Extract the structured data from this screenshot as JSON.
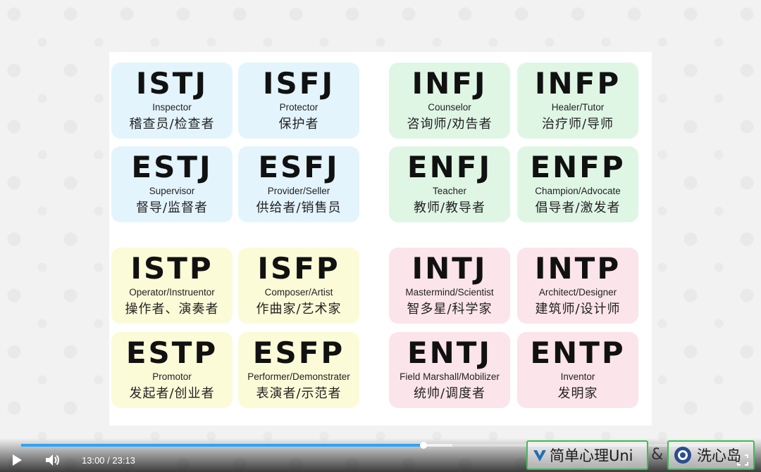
{
  "slide": {
    "cards": [
      {
        "code": "ISTJ",
        "en": "Inspector",
        "cn": "稽查员/检查者",
        "color": "#e3f4fd"
      },
      {
        "code": "ISFJ",
        "en": "Protector",
        "cn": "保护者",
        "color": "#e3f4fd"
      },
      {
        "code": "INFJ",
        "en": "Counselor",
        "cn": "咨询师/劝告者",
        "color": "#dff6e5"
      },
      {
        "code": "INFP",
        "en": "Healer/Tutor",
        "cn": "治疗师/导师",
        "color": "#dff6e5"
      },
      {
        "code": "ESTJ",
        "en": "Supervisor",
        "cn": "督导/监督者",
        "color": "#e3f4fd"
      },
      {
        "code": "ESFJ",
        "en": "Provider/Seller",
        "cn": "供给者/销售员",
        "color": "#e3f4fd"
      },
      {
        "code": "ENFJ",
        "en": "Teacher",
        "cn": "教师/教导者",
        "color": "#dff6e5"
      },
      {
        "code": "ENFP",
        "en": "Champion/Advocate",
        "cn": "倡导者/激发者",
        "color": "#dff6e5"
      },
      {
        "code": "ISTP",
        "en": "Operator/Instruentor",
        "cn": "操作者、演奏者",
        "color": "#fbfbd8"
      },
      {
        "code": "ISFP",
        "en": "Composer/Artist",
        "cn": "作曲家/艺术家",
        "color": "#fbfbd8"
      },
      {
        "code": "INTJ",
        "en": "Mastermind/Scientist",
        "cn": "智多星/科学家",
        "color": "#fbe4ea"
      },
      {
        "code": "INTP",
        "en": "Architect/Designer",
        "cn": "建筑师/设计师",
        "color": "#fbe4ea"
      },
      {
        "code": "ESTP",
        "en": "Promotor",
        "cn": "发起者/创业者",
        "color": "#fbfbd8"
      },
      {
        "code": "ESFP",
        "en": "Performer/Demonstrater",
        "cn": "表演者/示范者",
        "color": "#fbfbd8"
      },
      {
        "code": "ENTJ",
        "en": "Field Marshall/Mobilizer",
        "cn": "统帅/调度者",
        "color": "#fbe4ea"
      },
      {
        "code": "ENTP",
        "en": "Inventor",
        "cn": "发明家",
        "color": "#fbe4ea"
      }
    ]
  },
  "player": {
    "current_time": "13:00",
    "duration": "23:13",
    "time_display": "13:00 / 23:13",
    "progress_fraction": 0.56,
    "buffered_fraction": 0.6,
    "play_icon": "play-icon",
    "volume_icon": "volume-icon",
    "fullscreen_icon": "fullscreen-icon",
    "accent_color": "#2fa3f6"
  },
  "watermark": {
    "brand1": "简单心理Uni",
    "amp": "&",
    "brand2": "洗心岛",
    "border_color": "#3cbf4f"
  }
}
